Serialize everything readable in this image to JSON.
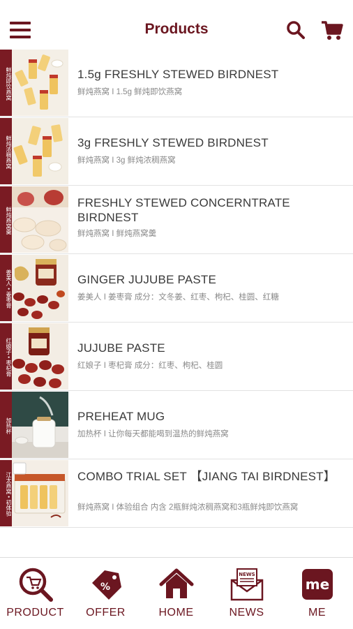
{
  "header": {
    "title": "Products",
    "menu_icon": "hamburger-menu-icon",
    "search_icon": "search-icon",
    "cart_icon": "shopping-cart-icon"
  },
  "colors": {
    "brand": "#6b1620",
    "strip": "#7a1b23"
  },
  "products": [
    {
      "strip": "鲜炖即饮燕窝",
      "title": "1.5g FRESHLY STEWED BIRDNEST",
      "subtitle": "鲜炖燕窝 I 1.5g 鲜炖即饮燕窝"
    },
    {
      "strip": "鲜炖浓稠燕窝",
      "title": "3g FRESHLY STEWED BIRDNEST",
      "subtitle": "鲜炖燕窝 I 3g 鲜炖浓稠燕窝"
    },
    {
      "strip": "鲜炖燕窝羹",
      "title": "FRESHLY STEWED CONCERNTRATE BIRDNEST",
      "subtitle": "鲜炖燕窝 I 鲜炖燕窝羹"
    },
    {
      "strip": "姜美人 • 姜枣膏",
      "title": "GINGER JUJUBE PASTE",
      "subtitle": "姜美人 I 姜枣膏 成分：文冬姜、红枣、枸杞、桂圆、红糖"
    },
    {
      "strip": "红娘子 • 枣杞膏",
      "title": "JUJUBE PASTE",
      "subtitle": "红娘子 I 枣杞膏 成分：红枣、枸杞、桂圆"
    },
    {
      "strip": "加热杯",
      "title": "PREHEAT MUG",
      "subtitle": "加热杯 I 让你每天都能喝到温热的鲜炖燕窝"
    },
    {
      "strip": "江太燕窝 • 初体验",
      "title": "COMBO TRIAL SET 【JIANG TAI BIRDNEST】",
      "subtitle": "鲜炖燕窝 I 体验组合 内含 2瓶鲜炖浓稠燕窝和3瓶鲜炖即饮燕窝"
    }
  ],
  "nav": [
    {
      "label": "PRODUCT",
      "icon": "product-search-icon"
    },
    {
      "label": "OFFER",
      "icon": "offer-tag-icon"
    },
    {
      "label": "HOME",
      "icon": "home-icon"
    },
    {
      "label": "NEWS",
      "icon": "news-envelope-icon"
    },
    {
      "label": "ME",
      "icon": "me-badge-icon",
      "badge_text": "me"
    }
  ]
}
